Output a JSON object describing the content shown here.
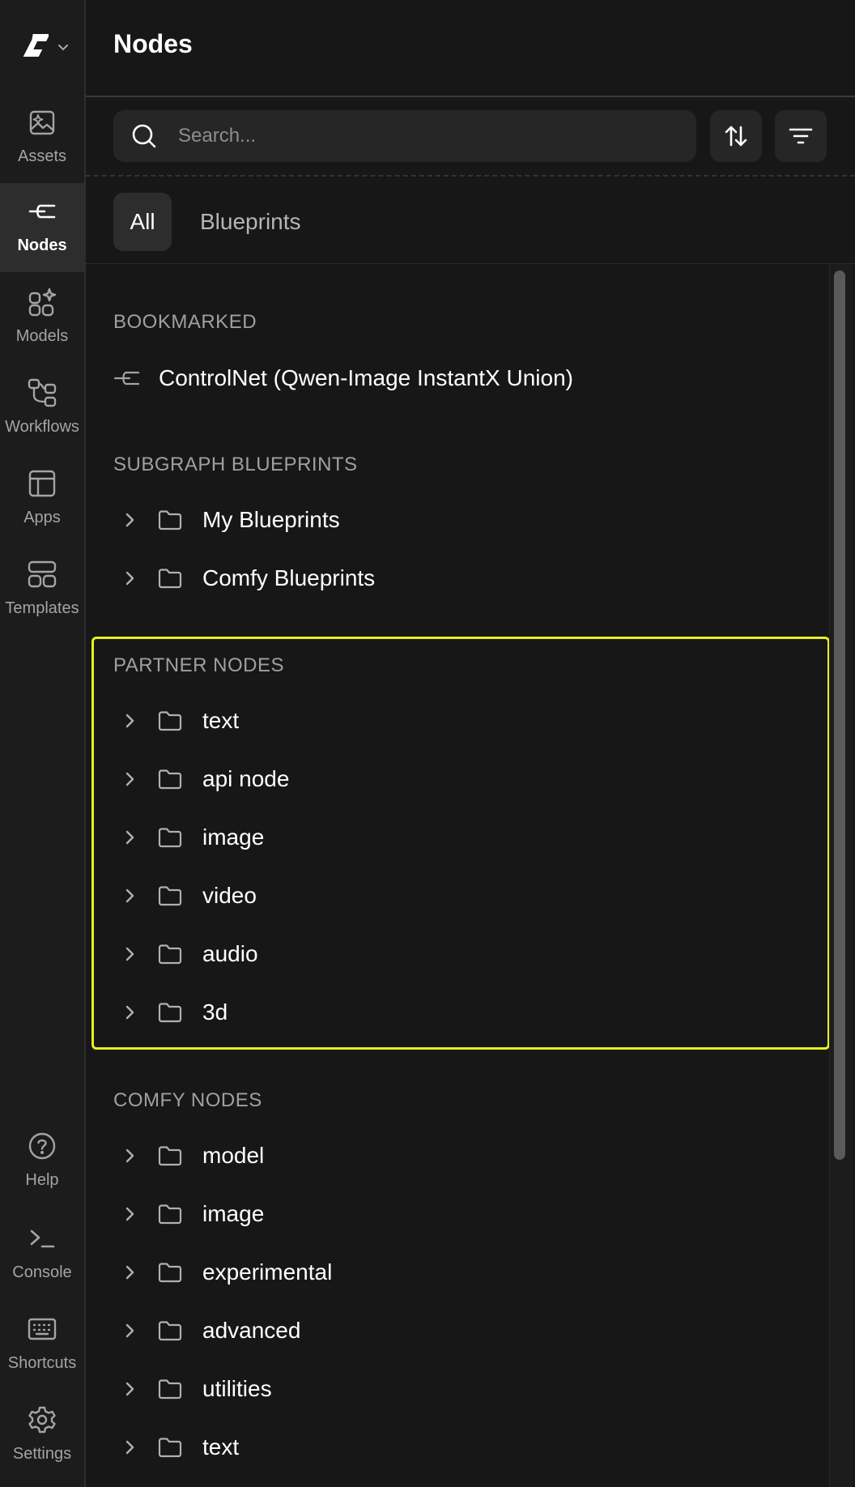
{
  "rail": {
    "items": [
      {
        "label": "Assets",
        "icon": "image-sparkle-icon",
        "active": false
      },
      {
        "label": "Nodes",
        "icon": "node-connector-icon",
        "active": true
      },
      {
        "label": "Models",
        "icon": "models-grid-icon",
        "active": false
      },
      {
        "label": "Workflows",
        "icon": "workflow-icon",
        "active": false
      },
      {
        "label": "Apps",
        "icon": "apps-layout-icon",
        "active": false
      },
      {
        "label": "Templates",
        "icon": "templates-icon",
        "active": false
      },
      {
        "label": "Help",
        "icon": "help-icon",
        "active": false
      },
      {
        "label": "Console",
        "icon": "console-icon",
        "active": false
      },
      {
        "label": "Shortcuts",
        "icon": "keyboard-icon",
        "active": false
      },
      {
        "label": "Settings",
        "icon": "gear-icon",
        "active": false
      }
    ]
  },
  "panel": {
    "title": "Nodes",
    "search_placeholder": "Search...",
    "tabs": [
      {
        "label": "All",
        "active": true
      },
      {
        "label": "Blueprints",
        "active": false
      }
    ],
    "bookmarked": {
      "heading": "BOOKMARKED",
      "items": [
        "ControlNet (Qwen-Image InstantX Union)"
      ]
    },
    "subgraph_blueprints": {
      "heading": "SUBGRAPH BLUEPRINTS",
      "items": [
        "My Blueprints",
        "Comfy Blueprints"
      ]
    },
    "partner_nodes": {
      "heading": "PARTNER NODES",
      "items": [
        "text",
        "api node",
        "image",
        "video",
        "audio",
        "3d"
      ]
    },
    "comfy_nodes": {
      "heading": "COMFY NODES",
      "items": [
        "model",
        "image",
        "experimental",
        "advanced",
        "utilities",
        "text"
      ]
    }
  },
  "colors": {
    "background": "#171717",
    "rail_background": "#1c1c1c",
    "active_item": "#2d2d2d",
    "highlight_border": "#e6f01e",
    "section_heading": "#a0a0a0"
  }
}
